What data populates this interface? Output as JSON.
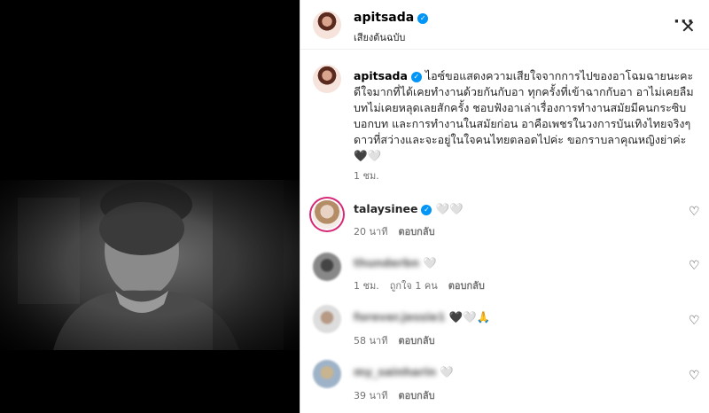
{
  "post": {
    "username": "apitsada",
    "audio_label": "เสียงต้นฉบับ",
    "more_label": "···",
    "close_label": "✕",
    "caption": "ไอซ์ขอแสดงความเสียใจจากการไปของอาโฉมฉายนะคะ ดีใจมากที่ได้เคยทำงานด้วยกันกับอา ทุกครั้งที่เข้าฉากกับอา อาไม่เคยลืมบทไม่เคยหลุดเลยสักครั้ง ชอบฟังอาเล่าเรื่องการทำงานสมัยมีคนกระซิบบอกบท และการทำงานในสมัยก่อน อาคือเพชรในวงการบันเทิงไทยจริงๆ ดาวที่สว่างและจะอยู่ในใจคนไทยตลอดไปค่ะ ขอกราบลาคุณหญิงย่าค่ะ 🖤🤍",
    "caption_time": "1 ชม."
  },
  "comments": [
    {
      "username": "talaysinee",
      "text": "🤍🤍",
      "time": "20 นาที",
      "likes": "",
      "reply": "ตอบกลับ",
      "verified": true
    },
    {
      "username": "thunderbn",
      "text": "🤍",
      "time": "1 ชม.",
      "likes": "ถูกใจ 1 คน",
      "reply": "ตอบกลับ",
      "verified": false
    },
    {
      "username": "forever.jessie1",
      "text": "🖤🤍🙏",
      "time": "58 นาที",
      "likes": "",
      "reply": "ตอบกลับ",
      "verified": false
    },
    {
      "username": "my_sainharin",
      "text": "🤍",
      "time": "39 นาที",
      "likes": "",
      "reply": "ตอบกลับ",
      "verified": false
    }
  ],
  "icons": {
    "like": "heart-outline",
    "verified": "verified-badge",
    "more": "ellipsis",
    "close": "close"
  }
}
